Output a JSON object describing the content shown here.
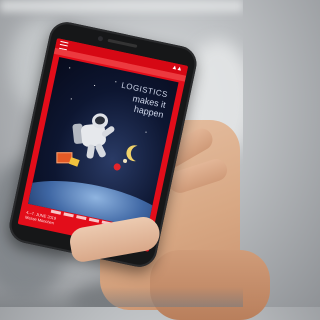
{
  "poster": {
    "tagline": [
      "LOGISTICS",
      "makes it",
      "happen"
    ],
    "date_line": [
      "4.–7. JUNE 2019",
      "Messe München"
    ],
    "brand_main_prefix": "transport",
    "brand_sub": "logistic"
  },
  "icons": {
    "menu": "hamburger-menu-icon",
    "logo": "brand-logo-icon"
  },
  "colors": {
    "screen_red": "#e30d1a",
    "poster_navy": "#0d1631",
    "accent_yellow": "#f7c21b"
  }
}
